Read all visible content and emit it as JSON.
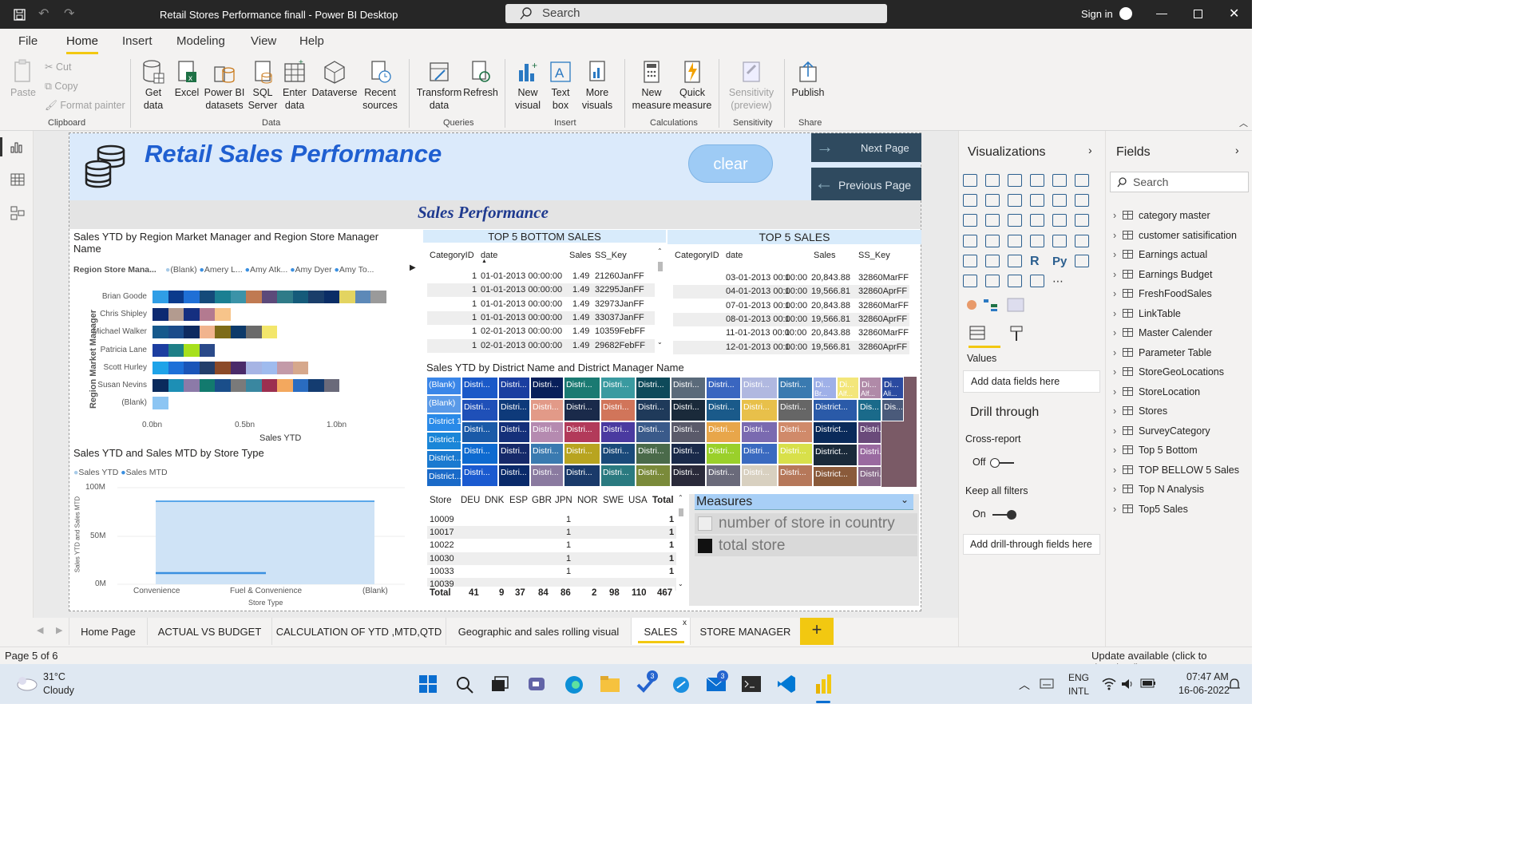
{
  "app": {
    "title": "Retail Stores Performance finall - Power BI Desktop",
    "search_placeholder": "Search",
    "sign_in": "Sign in"
  },
  "menu": [
    "File",
    "Home",
    "Insert",
    "Modeling",
    "View",
    "Help"
  ],
  "ribbon": {
    "clipboard": {
      "paste": "Paste",
      "cut": "Cut",
      "copy": "Copy",
      "format_painter": "Format painter",
      "group": "Clipboard"
    },
    "data": {
      "get_data": "Get data",
      "excel": "Excel",
      "pbi_datasets": "Power BI datasets",
      "sql_server": "SQL Server",
      "enter_data": "Enter data",
      "dataverse": "Dataverse",
      "recent_sources": "Recent sources",
      "group": "Data"
    },
    "queries": {
      "transform": "Transform data",
      "refresh": "Refresh",
      "group": "Queries"
    },
    "insert": {
      "new_visual": "New visual",
      "text_box": "Text box",
      "more_visuals": "More visuals",
      "group": "Insert"
    },
    "calculations": {
      "new_measure": "New measure",
      "quick_measure": "Quick measure",
      "group": "Calculations"
    },
    "sensitivity": {
      "label": "Sensitivity (preview)",
      "group": "Sensitivity"
    },
    "share": {
      "publish": "Publish",
      "group": "Share"
    }
  },
  "report": {
    "title": "Retail Sales Performance",
    "clear": "clear",
    "next_page": "Next Page",
    "prev_page": "Previous Page",
    "subtitle": "Sales  Performance",
    "bar_chart": {
      "title": "Sales YTD by Region Market Manager and Region Store Manager Name",
      "legend_label": "Region Store Mana...",
      "legend_items": [
        "(Blank)",
        "Amery L...",
        "Amy Atk...",
        "Amy Dyer",
        "Amy To..."
      ],
      "ylabel": "Region Market Manager",
      "xlabel": "Sales YTD",
      "ticks": [
        "0.0bn",
        "0.5bn",
        "1.0bn"
      ],
      "managers": [
        "Brian Goode",
        "Chris Shipley",
        "Michael Walker",
        "Patricia Lane",
        "Scott Hurley",
        "Susan Nevins",
        "(Blank)"
      ]
    },
    "area_chart": {
      "title": "Sales YTD and Sales MTD by Store Type",
      "legend": [
        "Sales YTD",
        "Sales MTD"
      ],
      "ylabel": "Sales YTD and Sales MTD",
      "xlabel": "Store Type",
      "yticks": [
        "100M",
        "50M",
        "0M"
      ],
      "categories": [
        "Convenience",
        "Fuel & Convenience",
        "(Blank)"
      ]
    },
    "bottom_table": {
      "title": "TOP 5 BOTTOM SALES",
      "headers": [
        "CategoryID",
        "date",
        "Sales",
        "SS_Key"
      ],
      "rows": [
        [
          "1",
          "01-01-2013 00:00:00",
          "1.49",
          "21260JanFF"
        ],
        [
          "1",
          "01-01-2013 00:00:00",
          "1.49",
          "32295JanFF"
        ],
        [
          "1",
          "01-01-2013 00:00:00",
          "1.49",
          "32973JanFF"
        ],
        [
          "1",
          "01-01-2013 00:00:00",
          "1.49",
          "33037JanFF"
        ],
        [
          "1",
          "02-01-2013 00:00:00",
          "1.49",
          "10359FebFF"
        ],
        [
          "1",
          "02-01-2013 00:00:00",
          "1.49",
          "29682FebFF"
        ]
      ]
    },
    "top_table": {
      "title": "TOP 5 SALES",
      "headers": [
        "CategoryID",
        "date",
        "Sales",
        "SS_Key"
      ],
      "rows": [
        [
          "1",
          "03-01-2013 00:00:00",
          "20,843.88",
          "32860MarFF"
        ],
        [
          "1",
          "04-01-2013 00:00:00",
          "19,566.81",
          "32860AprFF"
        ],
        [
          "1",
          "07-01-2013 00:00:00",
          "20,843.88",
          "32860MarFF"
        ],
        [
          "1",
          "08-01-2013 00:00:00",
          "19,566.81",
          "32860AprFF"
        ],
        [
          "1",
          "11-01-2013 00:00:00",
          "20,843.88",
          "32860MarFF"
        ],
        [
          "1",
          "12-01-2013 00:00:00",
          "19,566.81",
          "32860AprFF"
        ]
      ]
    },
    "treemap": {
      "title": "Sales YTD by District Name and District Manager Name",
      "col0": [
        "(Blank)",
        "(Blank)",
        "District 1",
        "District...",
        "District...",
        "District..."
      ],
      "cell": "Distri...",
      "small": [
        "Di...",
        "Di...",
        "Di...",
        "Di...",
        "Br...",
        "Alf...",
        "Alf...",
        "Ali...",
        "District...",
        "Dis...",
        "Dis...",
        "Am...",
        "Am...",
        "District...",
        "Distri...",
        "District...",
        "Distri..."
      ]
    },
    "matrix": {
      "headers": [
        "Store",
        "DEU",
        "DNK",
        "ESP",
        "GBR",
        "JPN",
        "NOR",
        "SWE",
        "USA",
        "Total"
      ],
      "rows": [
        [
          "10009",
          "1",
          "1"
        ],
        [
          "10017",
          "1",
          "1"
        ],
        [
          "10022",
          "1",
          "1"
        ],
        [
          "10030",
          "1",
          "1"
        ],
        [
          "10033",
          "1",
          "1"
        ],
        [
          "10039",
          "",
          ""
        ]
      ],
      "total": [
        "Total",
        "41",
        "9",
        "37",
        "84",
        "86",
        "2",
        "98",
        "110",
        "467"
      ]
    },
    "slicer": {
      "title": "Measures",
      "items": [
        "number of store in country",
        "total store"
      ]
    }
  },
  "viz_pane": {
    "title": "Visualizations",
    "values": "Values",
    "add_data": "Add data fields here",
    "drill": "Drill through",
    "cross": "Cross-report",
    "off": "Off",
    "keep": "Keep all filters",
    "on": "On",
    "add_drill": "Add drill-through fields here",
    "r": "R",
    "py": "Py"
  },
  "fields_pane": {
    "title": "Fields",
    "search": "Search",
    "items": [
      "category master",
      "customer satisification",
      "Earnings actual",
      "Earnings Budget",
      "FreshFoodSales",
      "LinkTable",
      "Master Calender",
      "Parameter Table",
      "StoreGeoLocations",
      "StoreLocation",
      "Stores",
      "SurveyCategory",
      "Top 5 Bottom",
      "TOP BELLOW 5 Sales",
      "Top N Analysis",
      "Top5 Sales"
    ]
  },
  "tabs": [
    "Home Page",
    "ACTUAL VS BUDGET",
    "CALCULATION OF YTD ,MTD,QTD",
    "Geographic and sales rolling visual",
    "SALES",
    "STORE MANAGER"
  ],
  "status": {
    "page": "Page 5 of 6",
    "update": "Update available (click to download)"
  },
  "taskbar": {
    "temp": "31°C",
    "weather": "Cloudy",
    "lang1": "ENG",
    "lang2": "INTL",
    "time": "07:47 AM",
    "date": "16-06-2022",
    "badge1": "3",
    "badge2": "3"
  }
}
